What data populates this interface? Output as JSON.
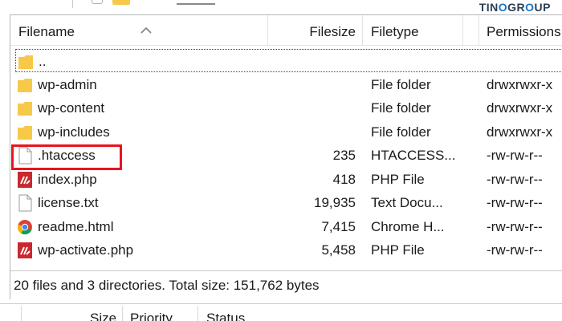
{
  "brand": {
    "text_a": "TIN",
    "text_o": "O",
    "text_b": "GR",
    "text_o2": "O",
    "text_c": "UP"
  },
  "columns": {
    "filename": "Filename",
    "filesize": "Filesize",
    "filetype": "Filetype",
    "permissions": "Permissions"
  },
  "files": [
    {
      "name": "..",
      "size": "",
      "type": "",
      "perm": "",
      "icon": "folder-icon"
    },
    {
      "name": "wp-admin",
      "size": "",
      "type": "File folder",
      "perm": "drwxrwxr-x",
      "icon": "folder-icon"
    },
    {
      "name": "wp-content",
      "size": "",
      "type": "File folder",
      "perm": "drwxrwxr-x",
      "icon": "folder-icon"
    },
    {
      "name": "wp-includes",
      "size": "",
      "type": "File folder",
      "perm": "drwxrwxr-x",
      "icon": "folder-icon"
    },
    {
      "name": ".htaccess",
      "size": "235",
      "type": "HTACCESS...",
      "perm": "-rw-rw-r--",
      "icon": "file-icon"
    },
    {
      "name": "index.php",
      "size": "418",
      "type": "PHP File",
      "perm": "-rw-rw-r--",
      "icon": "php-icon"
    },
    {
      "name": "license.txt",
      "size": "19,935",
      "type": "Text Docu...",
      "perm": "-rw-rw-r--",
      "icon": "file-icon"
    },
    {
      "name": "readme.html",
      "size": "7,415",
      "type": "Chrome H...",
      "perm": "-rw-rw-r--",
      "icon": "chrome-icon"
    },
    {
      "name": "wp-activate.php",
      "size": "5,458",
      "type": "PHP File",
      "perm": "-rw-rw-r--",
      "icon": "php-icon"
    }
  ],
  "status": {
    "text": "20 files and 3 directories. Total size: 151,762 bytes"
  },
  "queue": {
    "size": "Size",
    "priority": "Priority",
    "status": "Status"
  },
  "colors": {
    "highlight": "#e8141e",
    "folder": "#f7c948",
    "php": "#c8282e"
  }
}
